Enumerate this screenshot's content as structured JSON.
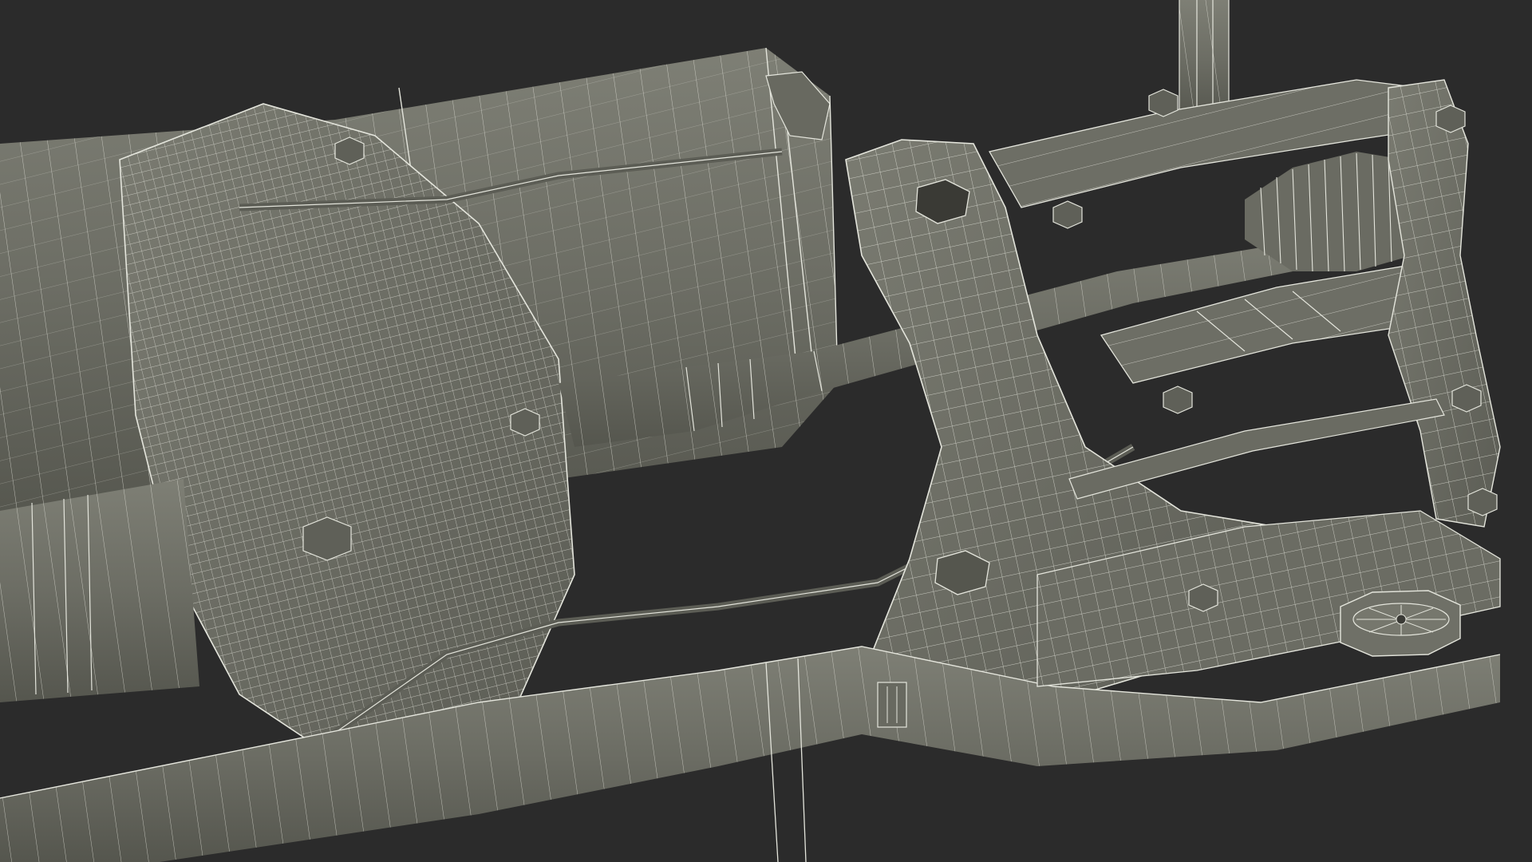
{
  "scene": {
    "background_color": "#2b2b2b",
    "mesh_fill_color": "#6e6f66",
    "mesh_fill_light": "#7c7d73",
    "mesh_fill_dark": "#55564f",
    "wire_color": "#e4e5dc",
    "shadow_color": "#222222"
  }
}
